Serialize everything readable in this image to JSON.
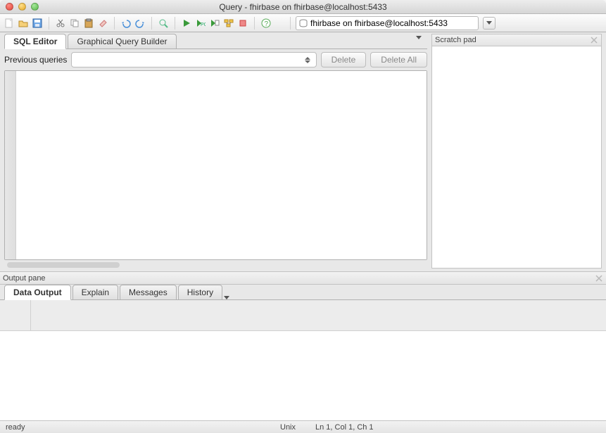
{
  "artifact_tab": "fhirbase",
  "title": "Query - fhirbase on fhirbase@localhost:5433",
  "toolbar": {
    "connection": "fhirbase on fhirbase@localhost:5433"
  },
  "editor_tabs": {
    "sql": "SQL Editor",
    "gqb": "Graphical Query Builder"
  },
  "previous": {
    "label": "Previous queries",
    "delete": "Delete",
    "delete_all": "Delete All"
  },
  "scratch": {
    "title": "Scratch pad"
  },
  "output": {
    "title": "Output pane",
    "tabs": {
      "data": "Data Output",
      "explain": "Explain",
      "messages": "Messages",
      "history": "History"
    }
  },
  "status": {
    "state": "ready",
    "encoding": "Unix",
    "position": "Ln 1, Col 1, Ch 1"
  }
}
